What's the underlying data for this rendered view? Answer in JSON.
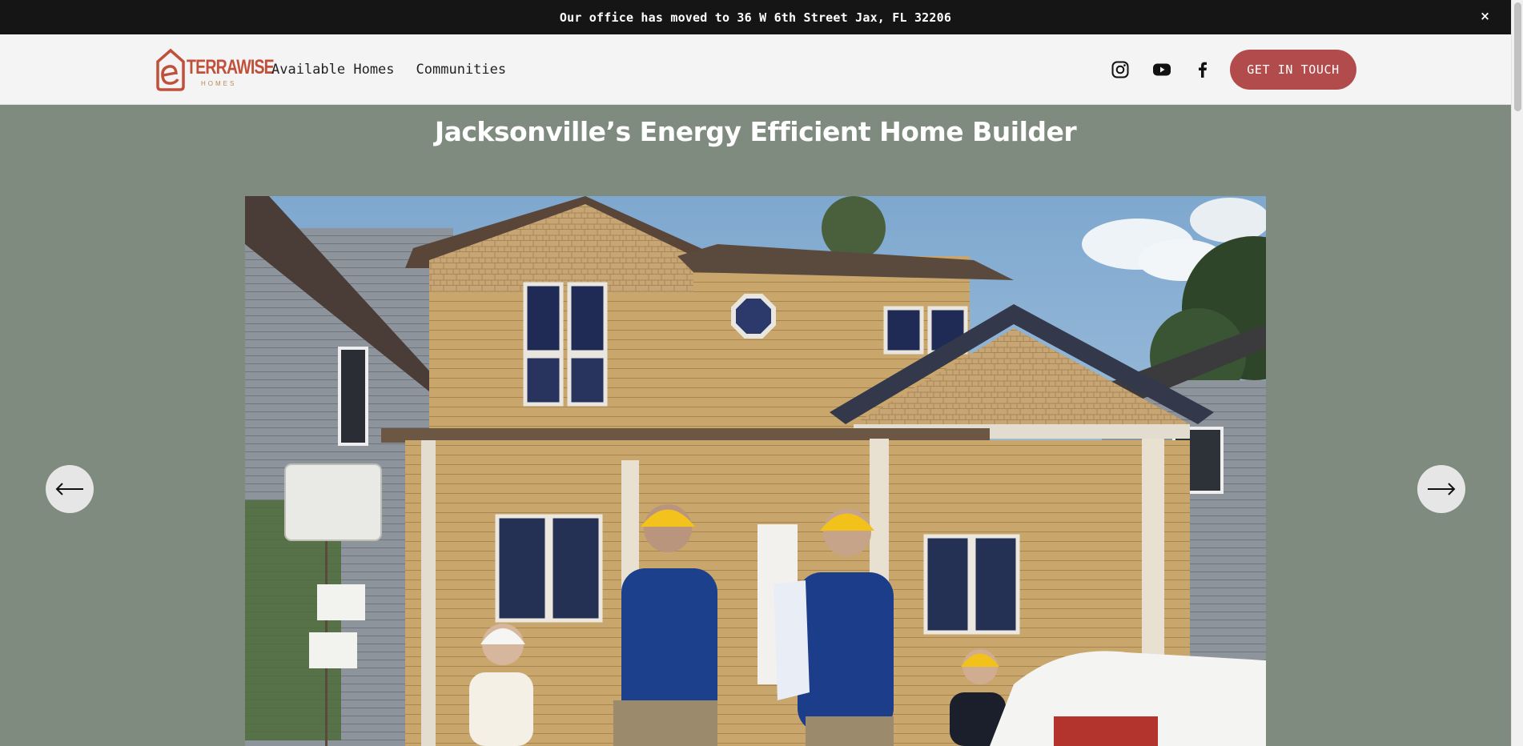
{
  "announcement": {
    "text": "Our office has moved to 36 W 6th Street Jax, FL 32206",
    "close_label": "×"
  },
  "header": {
    "logo": {
      "word": "TERRAWISE",
      "sub": "HOMES"
    },
    "nav": [
      {
        "label": "Available Homes"
      },
      {
        "label": "Communities"
      }
    ],
    "social_icons": [
      "instagram-icon",
      "youtube-icon",
      "facebook-icon"
    ],
    "cta_label": "GET IN TOUCH"
  },
  "hero": {
    "headline": "Jacksonville’s Energy Efficient Home Builder",
    "image_alt": "Family in hard hats looking at a new craftsman-style home under construction"
  },
  "carousel": {
    "prev_icon": "arrow-left-icon",
    "next_icon": "arrow-right-icon"
  },
  "colors": {
    "announcement_bg": "#151515",
    "header_bg": "#f4f4f4",
    "page_bg": "#7f8b7f",
    "accent": "#b24c4c",
    "logo": "#c1503b"
  }
}
